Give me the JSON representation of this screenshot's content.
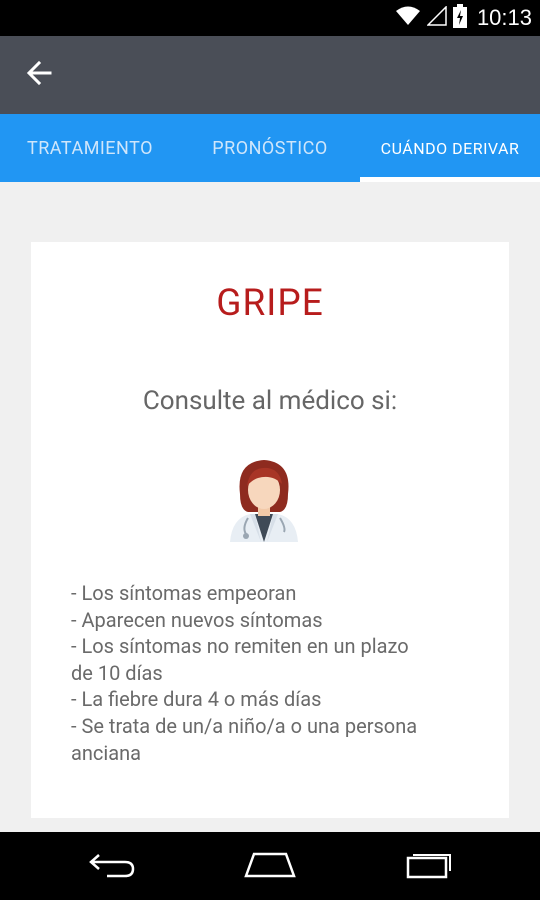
{
  "status_bar": {
    "time": "10:13"
  },
  "tabs": [
    {
      "label": "TRATAMIENTO",
      "active": false
    },
    {
      "label": "PRONÓSTICO",
      "active": false
    },
    {
      "label": "CUÁNDO DERIVAR",
      "active": true
    }
  ],
  "card": {
    "title": "GRIPE",
    "subtitle": "Consulte al médico si:",
    "symptoms": [
      "- Los síntomas empeoran",
      "- Aparecen nuevos síntomas",
      "- Los síntomas no remiten en un plazo",
      "de 10 días",
      "- La fiebre dura 4 o más días",
      "- Se trata de un/a niño/a o una persona",
      "anciana"
    ]
  },
  "icons": {
    "back": "arrow-back-icon",
    "doctor": "female-doctor-icon",
    "nav_back": "nav-back-icon",
    "nav_home": "nav-home-icon",
    "nav_recents": "nav-recents-icon"
  },
  "colors": {
    "app_bar": "#4a4e57",
    "tab_bar": "#2196f3",
    "title": "#b71c1c",
    "background": "#f0f0f0"
  }
}
